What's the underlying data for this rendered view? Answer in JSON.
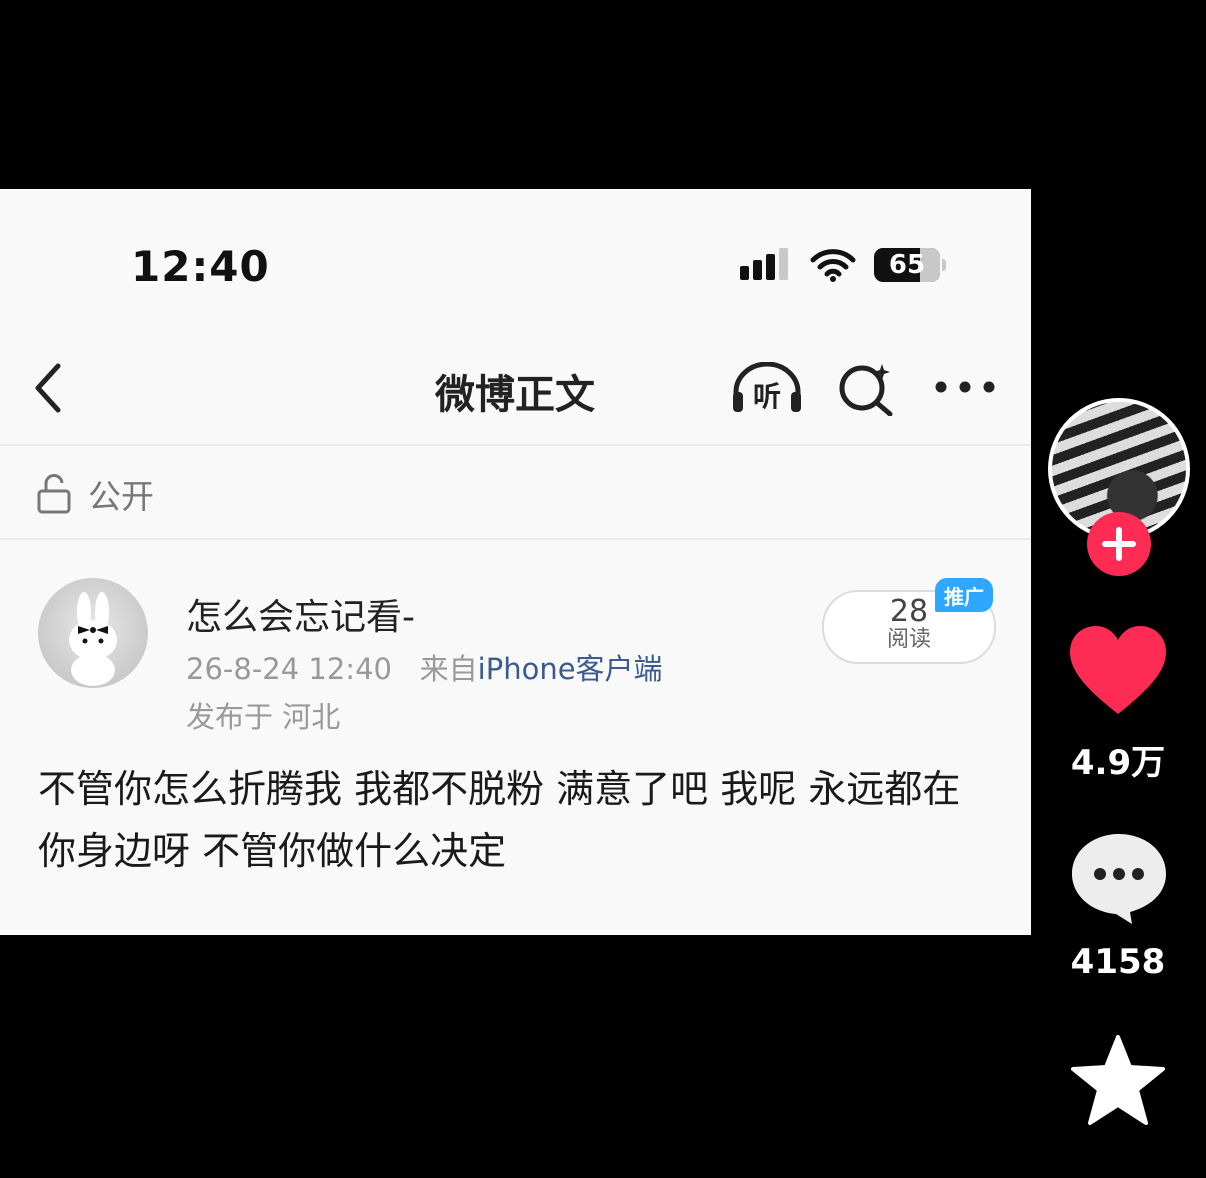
{
  "status_bar": {
    "time": "12:40",
    "battery": "65"
  },
  "nav": {
    "title": "微博正文",
    "listen_label": "听"
  },
  "visibility": {
    "label": "公开"
  },
  "post": {
    "username": "怎么会忘记看-",
    "date": "26-8-24 12:40",
    "source_prefix": "来自",
    "source_client": "iPhone客户端",
    "location": "发布于 河北",
    "read_count": "28",
    "read_label": "阅读",
    "promo_badge": "推广",
    "content": "不管你怎么折腾我 我都不脱粉 满意了吧 我呢 永远都在你身边呀 不管你做什么决定"
  },
  "side_actions": {
    "like_count": "4.9万",
    "comment_count": "4158"
  },
  "colors": {
    "like": "#fe2c55",
    "link": "#3b5b8f",
    "promo": "#2ea8ff"
  }
}
